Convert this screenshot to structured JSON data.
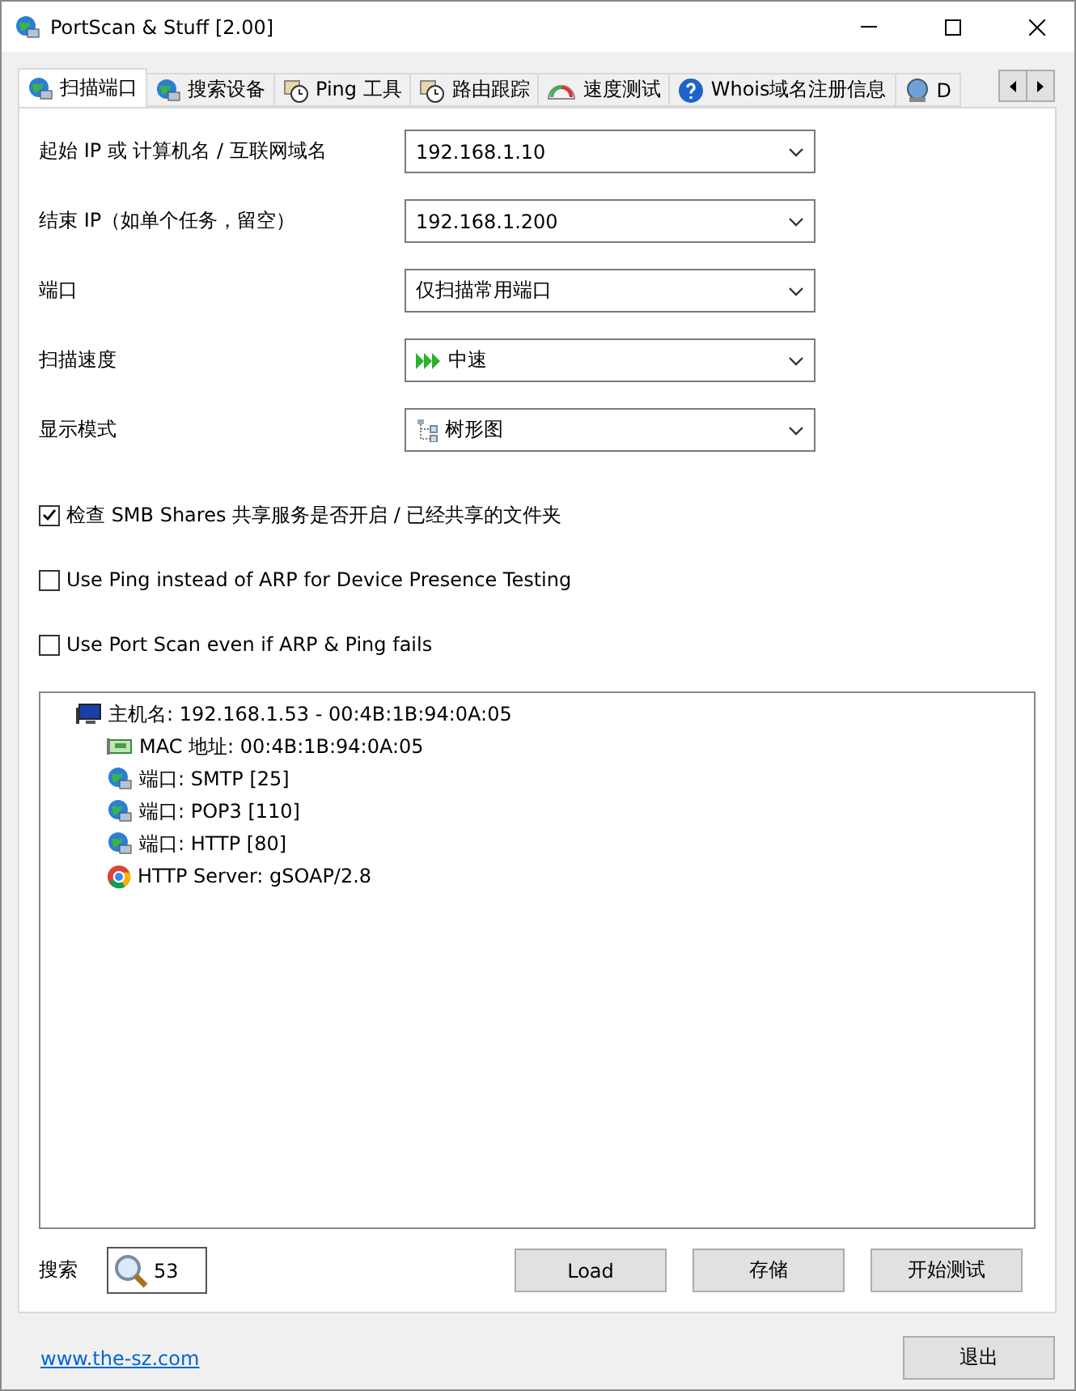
{
  "window": {
    "title": "PortScan & Stuff [2.00]"
  },
  "tabs": [
    {
      "label": "扫描端口",
      "selected": true
    },
    {
      "label": "搜索设备",
      "selected": false
    },
    {
      "label": "Ping 工具",
      "selected": false
    },
    {
      "label": "路由跟踪",
      "selected": false
    },
    {
      "label": "速度测试",
      "selected": false
    },
    {
      "label": "Whois域名注册信息",
      "selected": false
    },
    {
      "label": "D",
      "selected": false
    }
  ],
  "fields": [
    {
      "label": "起始 IP 或 计算机名 / 互联网域名",
      "value": "192.168.1.10"
    },
    {
      "label": "结束 IP（如单个任务，留空）",
      "value": "192.168.1.200"
    },
    {
      "label": "端口",
      "value": "仅扫描常用端口"
    },
    {
      "label": "扫描速度",
      "value": "中速"
    },
    {
      "label": "显示模式",
      "value": "树形图"
    }
  ],
  "checkboxes": [
    {
      "label": "检查 SMB Shares 共享服务是否开启 / 已经共享的文件夹",
      "checked": true
    },
    {
      "label": "Use Ping instead of ARP for Device Presence Testing",
      "checked": false
    },
    {
      "label": "Use Port Scan even if ARP & Ping fails",
      "checked": false
    }
  ],
  "tree": [
    {
      "kind": "host",
      "label": "主机名: 192.168.1.53 - 00:4B:1B:94:0A:05",
      "children": [
        {
          "kind": "mac",
          "label": "MAC 地址: 00:4B:1B:94:0A:05"
        },
        {
          "kind": "port",
          "label": "端口: SMTP [25]"
        },
        {
          "kind": "port",
          "label": "端口: POP3 [110]"
        },
        {
          "kind": "port",
          "label": "端口: HTTP [80]"
        },
        {
          "kind": "server",
          "label": "HTTP Server: gSOAP/2.8"
        }
      ]
    }
  ],
  "search": {
    "label": "搜索",
    "value": "53"
  },
  "buttons": [
    "Load",
    "存储",
    "开始测试"
  ],
  "link": "www.the-sz.com",
  "exit_button": "退出"
}
